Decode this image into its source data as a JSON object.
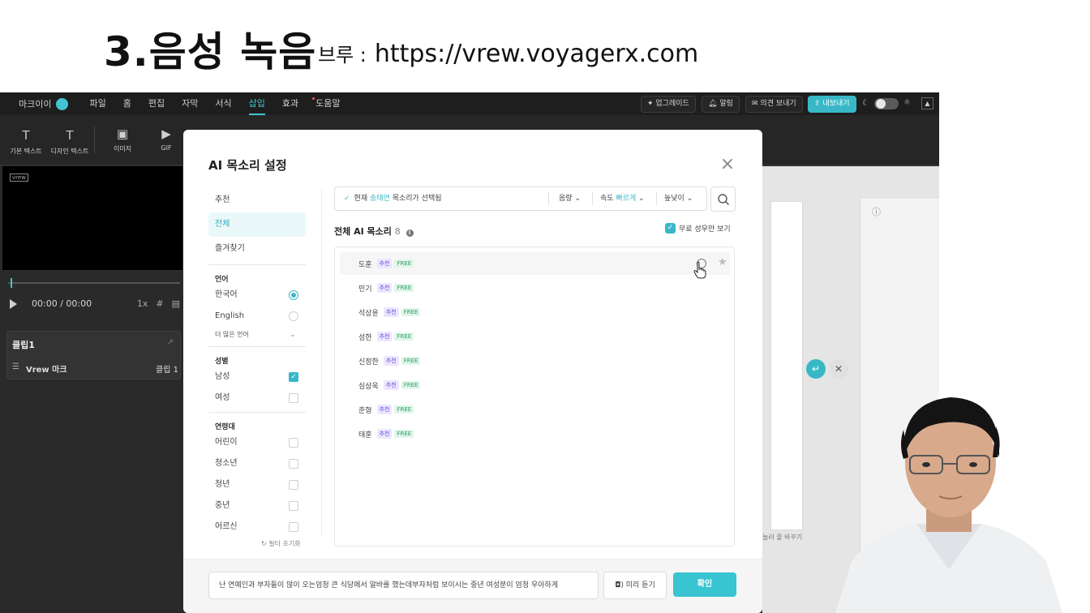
{
  "slide": {
    "title": "3.음성 녹음",
    "link_label": "브루 :",
    "link_url": "https://vrew.voyagerx.com"
  },
  "app": {
    "profile_name": "마크이이",
    "menus": [
      "파일",
      "홈",
      "편집",
      "자막",
      "서식",
      "삽입",
      "효과",
      "도움말"
    ],
    "active_menu": "삽입",
    "upgrade_label": "업그레이드",
    "alarm_label": "알림",
    "feedback_label": "의견 보내기",
    "export_label": "내보내기",
    "tools": [
      {
        "label": "기본 텍스트",
        "icon": "text-icon"
      },
      {
        "label": "디자인 텍스트",
        "icon": "design-text-icon"
      },
      {
        "label": "이미지",
        "icon": "image-icon"
      },
      {
        "label": "GIF",
        "icon": "gif-icon"
      }
    ],
    "time": "00:00 / 00:00",
    "speed": "1x",
    "clip_title": "클립1",
    "clip_row_label": "Vrew 마크",
    "clip_row_right": "클립 1",
    "editor_hint": "눌러 줄 바꾸기",
    "preview_watermark": "vrew",
    "colors": {
      "accent": "#38b8c7",
      "dark_bg": "#2a2a2a",
      "menubar_bg": "#1e1e1e"
    }
  },
  "modal": {
    "title": "AI 목소리 설정",
    "categories": [
      {
        "label": "추천",
        "selected": false
      },
      {
        "label": "전체",
        "selected": true
      },
      {
        "label": "즐겨찾기",
        "selected": false
      }
    ],
    "language": {
      "title": "언어",
      "options": [
        {
          "label": "한국어",
          "selected": true
        },
        {
          "label": "English",
          "selected": false
        }
      ],
      "more_label": "더 많은 언어"
    },
    "gender": {
      "title": "성별",
      "options": [
        {
          "label": "남성",
          "checked": true
        },
        {
          "label": "여성",
          "checked": false
        }
      ]
    },
    "age": {
      "title": "연령대",
      "options": [
        {
          "label": "어린이",
          "checked": false
        },
        {
          "label": "청소년",
          "checked": false
        },
        {
          "label": "청년",
          "checked": false
        },
        {
          "label": "중년",
          "checked": false
        },
        {
          "label": "어르신",
          "checked": false
        }
      ]
    },
    "reset_label": "필터 초기화",
    "current": {
      "prefix": "현재",
      "voice": "송태연",
      "suffix": "목소리가 선택됨"
    },
    "filters": {
      "volume": "음량",
      "speed_label": "속도",
      "speed_value": "빠르게",
      "pitch": "높낮이"
    },
    "list_title": "전체 AI 목소리",
    "list_count": "8",
    "free_only_label": "무료 성우만 보기",
    "free_only_checked": true,
    "voices": [
      {
        "name": "도훈",
        "tag_rec": "추천",
        "tag_free": "FREE"
      },
      {
        "name": "민기",
        "tag_rec": "추천",
        "tag_free": "FREE"
      },
      {
        "name": "석상윤",
        "tag_rec": "추천",
        "tag_free": "FREE"
      },
      {
        "name": "성한",
        "tag_rec": "추천",
        "tag_free": "FREE"
      },
      {
        "name": "신정한",
        "tag_rec": "추천",
        "tag_free": "FREE"
      },
      {
        "name": "심상욱",
        "tag_rec": "추천",
        "tag_free": "FREE"
      },
      {
        "name": "준형",
        "tag_rec": "추천",
        "tag_free": "FREE"
      },
      {
        "name": "태훈",
        "tag_rec": "추천",
        "tag_free": "FREE"
      }
    ],
    "sample_text": "난 연예인과 부자들이 많이 오는엄청 큰 식당에서 알바를 했는데부자처럼 보이시는 중년 여성분이 엄청 우아하게",
    "preview_label": "미리 듣기",
    "confirm_label": "확인"
  }
}
